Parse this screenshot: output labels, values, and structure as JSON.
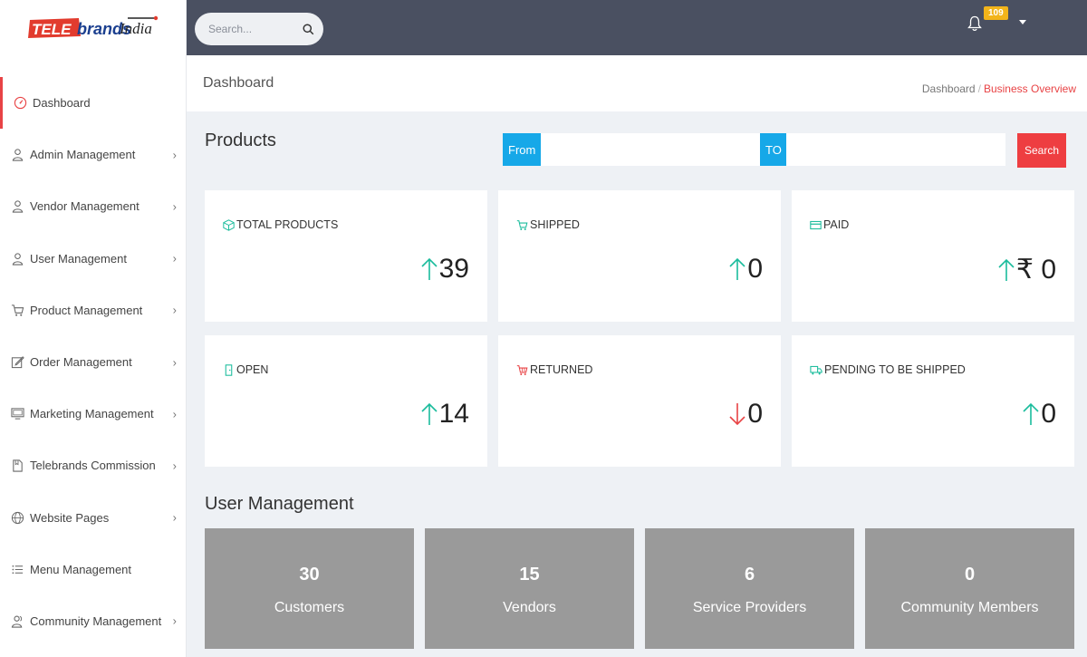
{
  "brand": {
    "tele": "TELE",
    "brands": "brands",
    "india": "India"
  },
  "topbar": {
    "search_placeholder": "Search...",
    "notification_count": "109"
  },
  "sidebar": {
    "items": [
      {
        "label": "Dashboard",
        "icon": "dashboard-gauge-icon",
        "active": true,
        "has_children": false
      },
      {
        "label": "Admin Management",
        "icon": "user-icon",
        "has_children": true
      },
      {
        "label": "Vendor Management",
        "icon": "user-icon",
        "has_children": true
      },
      {
        "label": "User Management",
        "icon": "user-icon",
        "has_children": true
      },
      {
        "label": "Product Management",
        "icon": "cart-icon",
        "has_children": true
      },
      {
        "label": "Order Management",
        "icon": "edit-icon",
        "has_children": true
      },
      {
        "label": "Marketing Management",
        "icon": "monitor-icon",
        "has_children": true
      },
      {
        "label": "Telebrands Commission",
        "icon": "document-icon",
        "has_children": true
      },
      {
        "label": "Website Pages",
        "icon": "globe-icon",
        "has_children": true
      },
      {
        "label": "Menu Management",
        "icon": "list-icon",
        "has_children": false
      },
      {
        "label": "Community Management",
        "icon": "users-icon",
        "has_children": true
      }
    ]
  },
  "header": {
    "title": "Dashboard",
    "breadcrumb": [
      "Dashboard",
      "Business Overview"
    ]
  },
  "products": {
    "title": "Products",
    "from_label": "From",
    "to_label": "TO",
    "from_value": "",
    "to_value": "",
    "search_label": "Search",
    "cards": [
      {
        "label": "TOTAL PRODUCTS",
        "value": "39",
        "trend": "up",
        "icon": "box-icon"
      },
      {
        "label": "SHIPPED",
        "value": "0",
        "trend": "up",
        "icon": "cart-icon"
      },
      {
        "label": "PAID",
        "value": "₹ 0",
        "trend": "up",
        "icon": "credit-card-icon"
      },
      {
        "label": "OPEN",
        "value": "14",
        "trend": "up",
        "icon": "door-icon"
      },
      {
        "label": "RETURNED",
        "value": "0",
        "trend": "down",
        "icon": "return-cart-icon"
      },
      {
        "label": "PENDING TO BE SHIPPED",
        "value": "0",
        "trend": "up",
        "icon": "truck-icon"
      }
    ]
  },
  "user_management": {
    "title": "User Management",
    "cards": [
      {
        "value": "30",
        "label": "Customers"
      },
      {
        "value": "15",
        "label": "Vendors"
      },
      {
        "value": "6",
        "label": "Service Providers"
      },
      {
        "value": "0",
        "label": "Community Members"
      }
    ]
  },
  "colors": {
    "accent_red": "#e84345",
    "accent_blue": "#16a8e8",
    "trend_up": "#1abc9c",
    "trend_down": "#e84345",
    "topbar": "#4a5061",
    "user_card": "#9a9a9a"
  }
}
